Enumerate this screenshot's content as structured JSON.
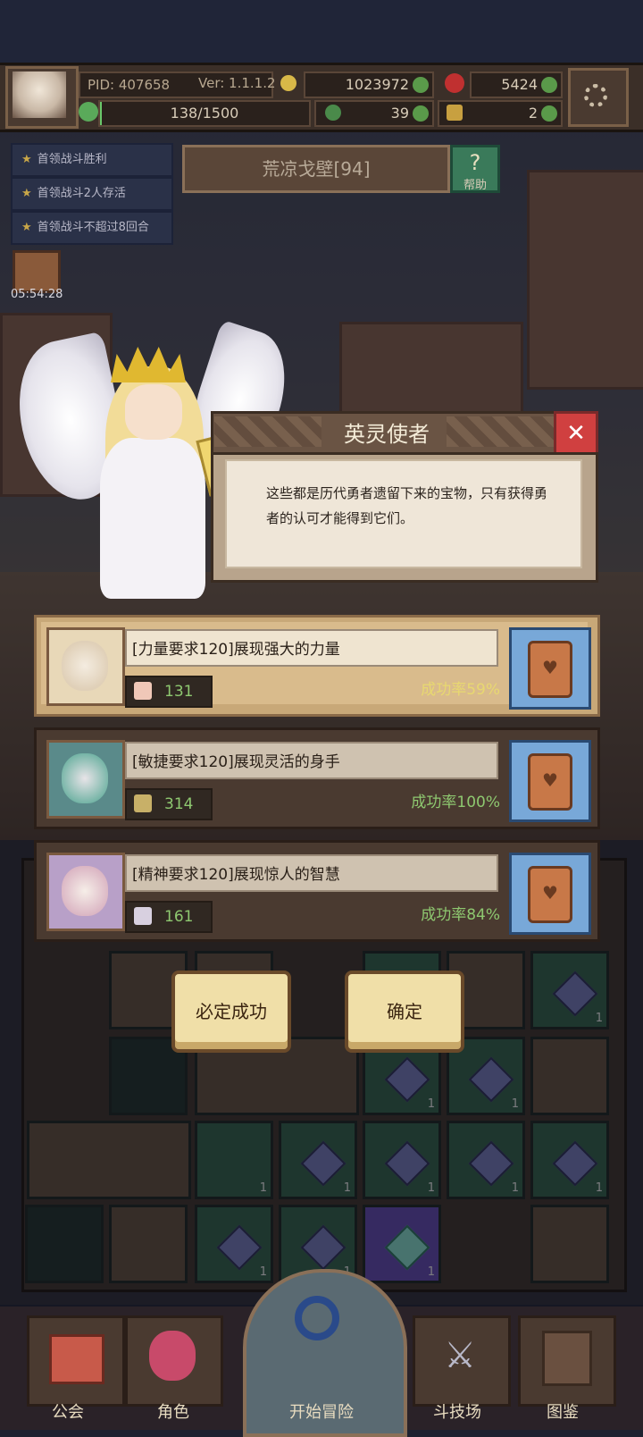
{
  "header": {
    "pid": "PID: 407658",
    "version": "Ver: 1.1.1.2",
    "gold": "1023972",
    "gems": "5424",
    "stamina": "138/1500",
    "clover": "39",
    "keys": "2"
  },
  "quests": [
    {
      "label": "首领战斗胜利"
    },
    {
      "label": "首领战斗2人存活"
    },
    {
      "label": "首领战斗不超过8回合"
    }
  ],
  "chest_timer": "05:54:28",
  "zone": {
    "name": "荒凉戈壁[94]",
    "help_label": "帮助",
    "help_icon": "?"
  },
  "dialog": {
    "title": "英灵使者",
    "text": "这些都是历代勇者遗留下来的宝物，只有获得勇者的认可才能得到它们。",
    "close_icon": "✕"
  },
  "options": [
    {
      "label": "[力量要求120]展现强大的力量",
      "stat_icon": "fist-icon",
      "stat_value": "131",
      "rate": "成功率59%",
      "rate_color": "#e8d870"
    },
    {
      "label": "[敏捷要求120]展现灵活的身手",
      "stat_icon": "boot-icon",
      "stat_value": "314",
      "rate": "成功率100%",
      "rate_color": "#8ec870"
    },
    {
      "label": "[精神要求120]展现惊人的智慧",
      "stat_icon": "book-icon",
      "stat_value": "161",
      "rate": "成功率84%",
      "rate_color": "#8ec870"
    }
  ],
  "buttons": {
    "guarantee": "必定成功",
    "confirm": "确定"
  },
  "grid_counts": [
    "1",
    "1",
    "1",
    "1",
    "1",
    "1",
    "1",
    "1",
    "1",
    "1",
    "1",
    "1",
    "1"
  ],
  "nav": [
    {
      "label": "公会",
      "icon": "guild-icon"
    },
    {
      "label": "角色",
      "icon": "character-icon"
    },
    {
      "label": "开始冒险",
      "icon": "magnifier-icon"
    },
    {
      "label": "斗技场",
      "icon": "swords-icon"
    },
    {
      "label": "图鉴",
      "icon": "codex-icon"
    }
  ],
  "colors": {
    "accent": "#c8a878",
    "success_high": "#8ec870",
    "success_mid": "#e8d870",
    "close": "#d04040"
  }
}
